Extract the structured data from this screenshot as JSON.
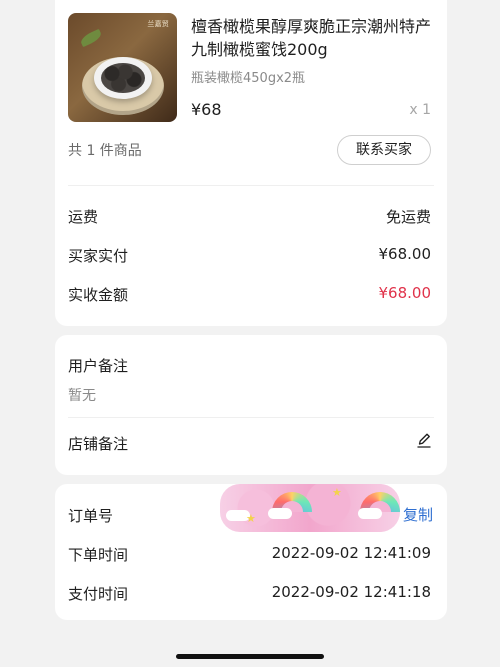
{
  "product": {
    "title": "  檀香橄榄果醇厚爽脆正宗潮州特产九制橄榄蜜饯200g",
    "spec": "瓶装橄榄450gx2瓶",
    "price": "¥68",
    "quantity": "x 1",
    "image_brand": "兰嘉贸",
    "image_icon": "product-thumbnail"
  },
  "summary": {
    "items_count": "共 1 件商品",
    "contact_seller": "联系买家"
  },
  "fees": [
    {
      "label": "运费",
      "value": "免运费"
    },
    {
      "label": "买家实付",
      "value": "¥68.00"
    },
    {
      "label": "实收金额",
      "value": "¥68.00"
    }
  ],
  "remarks": {
    "user_note_label": "用户备注",
    "user_note_value": "暂无",
    "store_note_label": "店铺备注",
    "edit_icon": "edit-pencil-icon"
  },
  "order": {
    "order_no_label": "订单号",
    "copy_label": "复制",
    "order_time_label": "下单时间",
    "order_time_value": "2022-09-02 12:41:09",
    "pay_time_label": "支付时间",
    "pay_time_value": "2022-09-02 12:41:18"
  },
  "colors": {
    "accent_red": "#e0324a",
    "link_blue": "#2f6fd1",
    "background": "#f2f2f2"
  }
}
